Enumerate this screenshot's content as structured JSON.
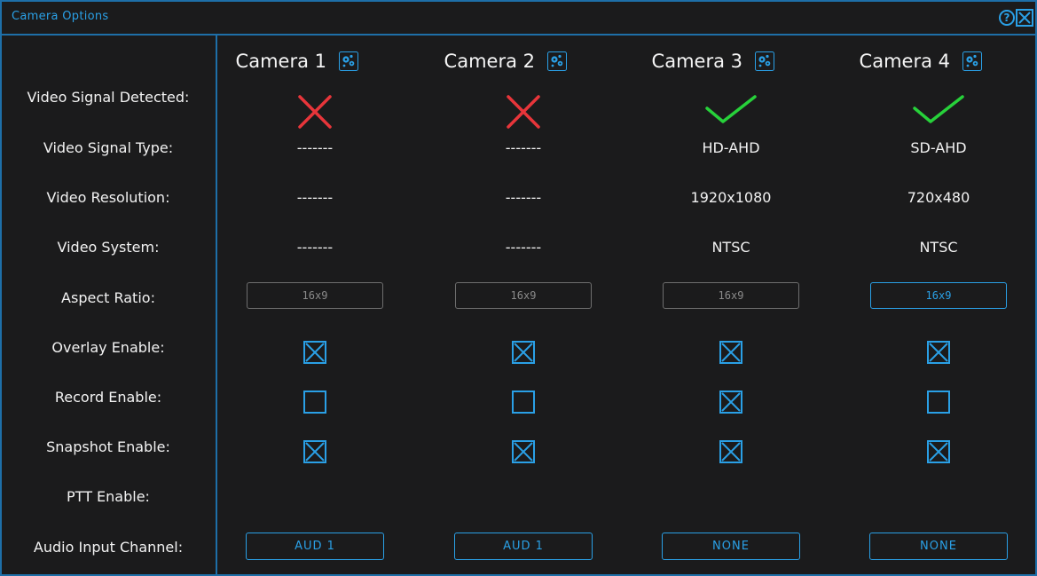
{
  "window": {
    "title": "Camera Options",
    "help_icon": "question-circle-icon",
    "close_icon": "close-x-icon"
  },
  "colors": {
    "accent": "#2aa0e6",
    "background": "#1b1b1c",
    "error": "#e8353a",
    "ok": "#27d13a",
    "border": "#1e6fa8"
  },
  "labels": {
    "video_signal_detected": "Video Signal Detected:",
    "video_signal_type": "Video Signal Type:",
    "video_resolution": "Video Resolution:",
    "video_system": "Video System:",
    "aspect_ratio": "Aspect Ratio:",
    "overlay_enable": "Overlay Enable:",
    "record_enable": "Record Enable:",
    "snapshot_enable": "Snapshot Enable:",
    "ptt_enable": "PTT Enable:",
    "audio_input_channel": "Audio Input Channel:"
  },
  "cameras": [
    {
      "name": "Camera 1",
      "signal_detected": false,
      "signal_type": "-------",
      "resolution": "-------",
      "system": "-------",
      "aspect_ratio": "16x9",
      "aspect_active": false,
      "overlay": true,
      "record": false,
      "snapshot": true,
      "audio": "AUD 1"
    },
    {
      "name": "Camera 2",
      "signal_detected": false,
      "signal_type": "-------",
      "resolution": "-------",
      "system": "-------",
      "aspect_ratio": "16x9",
      "aspect_active": false,
      "overlay": true,
      "record": false,
      "snapshot": true,
      "audio": "AUD 1"
    },
    {
      "name": "Camera 3",
      "signal_detected": true,
      "signal_type": "HD-AHD",
      "resolution": "1920x1080",
      "system": "NTSC",
      "aspect_ratio": "16x9",
      "aspect_active": false,
      "overlay": true,
      "record": true,
      "snapshot": true,
      "audio": "NONE"
    },
    {
      "name": "Camera 4",
      "signal_detected": true,
      "signal_type": "SD-AHD",
      "resolution": "720x480",
      "system": "NTSC",
      "aspect_ratio": "16x9",
      "aspect_active": true,
      "overlay": true,
      "record": false,
      "snapshot": true,
      "audio": "NONE"
    }
  ]
}
